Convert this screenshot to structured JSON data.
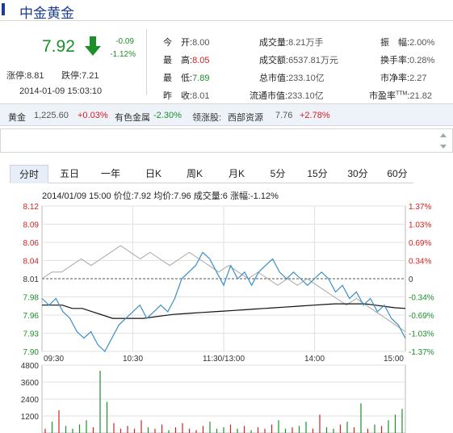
{
  "title": "中金黄金",
  "quote": {
    "price": "7.92",
    "change": "-0.09",
    "change_pct": "-1.12%",
    "limit_up_label": "涨停:",
    "limit_up": "8.81",
    "limit_down_label": "跌停:",
    "limit_down": "7.21",
    "timestamp": "2014-01-09 15:03:10"
  },
  "stats": {
    "open_label": "今　开:",
    "open": "8.00",
    "high_label": "最　高:",
    "high": "8.05",
    "low_label": "最　低:",
    "low": "7.89",
    "prev_label": "昨　收:",
    "prev": "8.01",
    "volume_label": "成交量:",
    "volume": "8.21万手",
    "amount_label": "成交额:",
    "amount": "6537.81万元",
    "mktcap_label": "总市值:",
    "mktcap": "233.10亿",
    "float_label": "流通市值:",
    "float": "233.10亿",
    "amp_label": "振　幅:",
    "amp": "2.00%",
    "turnover_label": "换手率:",
    "turnover": "0.28%",
    "pb_label": "市净率:",
    "pb": "2.27",
    "pe_label": "市盈率",
    "pe_sup": "TTM",
    "pe_colon": ":",
    "pe": "21.82"
  },
  "ticker": {
    "gold_label": "黄金",
    "gold_value": "1,225.60",
    "gold_change": "+0.03%",
    "sector_label": "有色金属",
    "sector_change": "-2.30%",
    "leader_label": "领涨股:",
    "leader_name": "西部资源",
    "leader_price": "7.76",
    "leader_change": "+2.78%"
  },
  "tabs": [
    "分时",
    "五日",
    "一年",
    "日K",
    "周K",
    "月K",
    "5分",
    "15分",
    "30分",
    "60分"
  ],
  "chart_header": "2014/01/09 15:00  价位:7.92  均价:7.96  成交量:6  涨幅:-1.12%",
  "colors": {
    "up": "#d42020",
    "down": "#1a8f2a",
    "price_line": "#3a8fc6",
    "avg_line": "#111111",
    "prev_line": "#a8a8a8",
    "brand": "#1a3d8f"
  },
  "chart_data": {
    "type": "line",
    "y_left_ticks": [
      "8.12",
      "8.09",
      "8.06",
      "8.04",
      "8.01",
      "7.98",
      "7.96",
      "7.93",
      "7.90"
    ],
    "y_right_ticks": [
      "1.37%",
      "1.03%",
      "0.69%",
      "0.34%",
      "0",
      "-0.34%",
      "-0.69%",
      "-1.03%",
      "-1.37%"
    ],
    "x_ticks": [
      "09:30",
      "10:30",
      "11:30/13:00",
      "14:00",
      "15:00"
    ],
    "ylim": [
      7.9,
      8.12
    ],
    "prev_close": 8.01,
    "price_series": [
      7.98,
      7.97,
      7.98,
      7.96,
      7.95,
      7.93,
      7.92,
      7.93,
      7.91,
      7.9,
      7.92,
      7.94,
      7.95,
      7.96,
      7.97,
      7.95,
      7.96,
      7.97,
      7.96,
      7.98,
      8.01,
      8.02,
      8.03,
      8.05,
      8.04,
      8.02,
      8.0,
      8.03,
      8.01,
      8.02,
      8.0,
      8.02,
      8.03,
      8.04,
      8.02,
      8.01,
      8.02,
      8.01,
      8.0,
      8.01,
      8.02,
      8.01,
      7.99,
      8.0,
      7.98,
      7.99,
      7.97,
      7.98,
      7.96,
      7.97,
      7.95,
      7.94,
      7.92
    ],
    "avg_series": [
      7.97,
      7.97,
      7.97,
      7.965,
      7.965,
      7.96,
      7.955,
      7.95,
      7.95,
      7.95,
      7.95,
      7.952,
      7.954,
      7.956,
      7.957,
      7.958,
      7.959,
      7.96,
      7.961,
      7.962,
      7.963,
      7.964,
      7.965,
      7.966,
      7.967,
      7.968,
      7.969,
      7.97,
      7.971,
      7.972,
      7.972,
      7.972,
      7.972,
      7.97,
      7.968,
      7.966,
      7.965
    ],
    "ref_series": [
      8.01,
      8.02,
      8.02,
      8.03,
      8.04,
      8.03,
      8.04,
      8.05,
      8.06,
      8.05,
      8.04,
      8.05,
      8.04,
      8.03,
      8.04,
      8.05,
      8.04,
      8.03,
      8.02,
      8.03,
      8.02,
      8.01,
      8.02,
      8.01,
      8.0,
      8.01,
      8.0,
      8.01,
      8.0,
      7.99,
      7.98,
      7.97,
      7.98,
      7.97,
      7.96,
      7.95,
      7.94,
      7.93
    ],
    "vol_ticks": [
      "4800",
      "3600",
      "2400",
      "1200"
    ],
    "vol_ylim": [
      0,
      4800
    ],
    "volumes": [
      300,
      800,
      1600,
      500,
      300,
      600,
      900,
      400,
      4400,
      2200,
      700,
      300,
      500,
      300,
      900,
      400,
      300,
      600,
      200,
      400,
      700,
      300,
      200,
      500,
      800,
      300,
      400,
      600,
      300,
      500,
      200,
      400,
      300,
      600,
      900,
      300,
      400,
      500,
      800,
      300,
      1300,
      400,
      300,
      600,
      800,
      400,
      2100,
      300,
      600,
      500,
      900,
      1300,
      1700
    ]
  }
}
